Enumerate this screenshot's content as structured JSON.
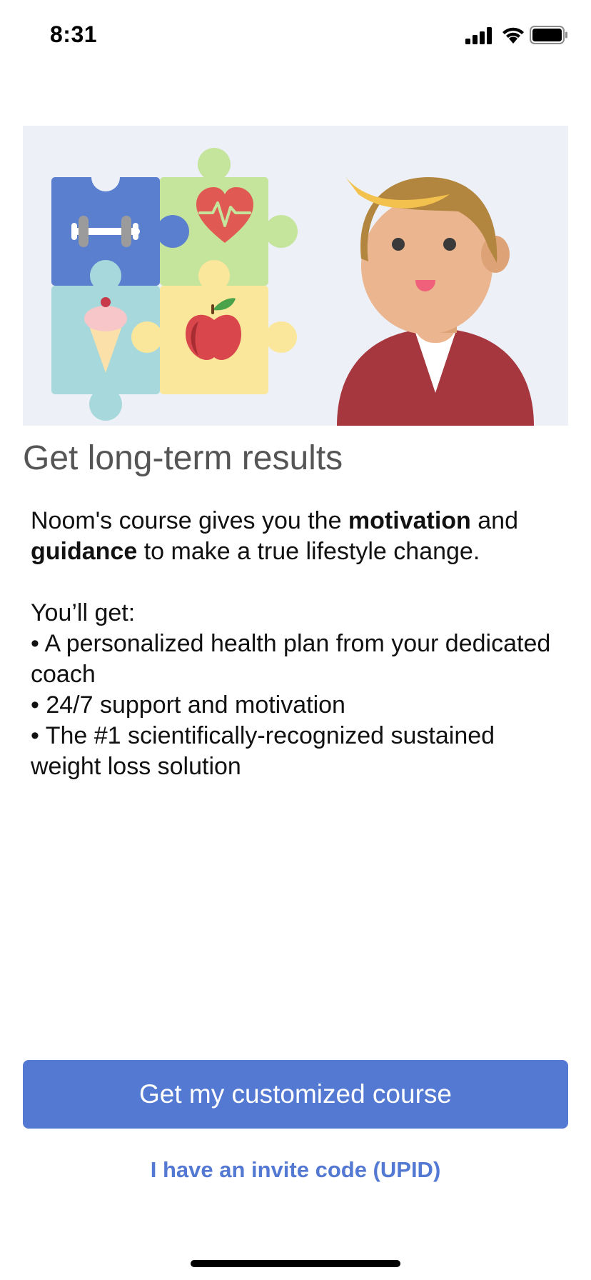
{
  "status_bar": {
    "time": "8:31",
    "icons": [
      "signal-icon",
      "wifi-icon",
      "battery-icon"
    ]
  },
  "hero": {
    "icons": [
      "dumbbell-icon",
      "heart-pulse-icon",
      "ice-cream-icon",
      "apple-icon",
      "coach-avatar"
    ]
  },
  "content": {
    "headline": "Get long-term results",
    "intro": {
      "part1": "Noom's course gives you the ",
      "bold1": "motivation",
      "part2": " and ",
      "bold2": "guidance",
      "part3": " to make a true lifestyle change."
    },
    "list_title": "You’ll get:",
    "bullets": [
      "• A personalized health plan from your dedicated coach",
      "• 24/7 support and motivation",
      "• The #1 scientifically-recognized sustained weight loss solution"
    ]
  },
  "actions": {
    "primary_label": "Get my customized course",
    "invite_label": "I have an invite code (UPID)"
  },
  "colors": {
    "accent": "#5479d2",
    "hero_bg": "#edf1f7",
    "puzzle_blue": "#5b7fcf",
    "puzzle_green": "#c5e49c",
    "puzzle_teal": "#a7d9dc",
    "puzzle_yellow": "#fbe79b",
    "shirt": "#a7373f",
    "hair": "#b2863f",
    "skin": "#eab58f"
  }
}
